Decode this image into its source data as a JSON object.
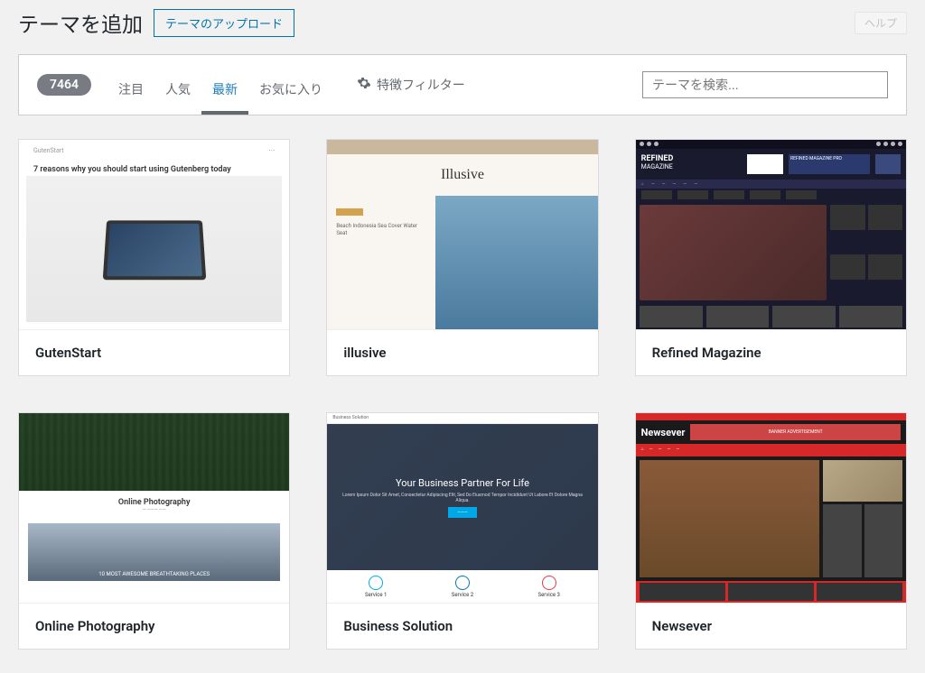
{
  "header": {
    "title": "テーマを追加",
    "upload_btn": "テーマのアップロード",
    "help_btn": "ヘルプ"
  },
  "filter": {
    "count": "7464",
    "tabs": {
      "featured": "注目",
      "popular": "人気",
      "latest": "最新",
      "favorites": "お気に入り"
    },
    "feature_filter": "特徴フィルター",
    "search_placeholder": "テーマを検索..."
  },
  "themes": [
    {
      "name": "GutenStart",
      "preview_title": "GutenStart",
      "preview_text": "7 reasons why you should start using Gutenberg today"
    },
    {
      "name": "illusive",
      "preview_logo": "Illusive",
      "preview_text": "Beach Indonesia Sea Cover Water Seat"
    },
    {
      "name": "Refined Magazine",
      "preview_brand": "REFINED",
      "preview_sub": "MAGAZINE",
      "preview_box": "REFINED MAGAZINE PRO"
    },
    {
      "name": "Online Photography",
      "preview_title": "Online Photography",
      "preview_caption": "10 MOST AWESOME BREATHTAKING PLACES"
    },
    {
      "name": "Business Solution",
      "preview_brand": "Business Solution",
      "preview_hero": "Your Business Partner For Life",
      "preview_text": "Lorem Ipsum Dolor Sit Amet, Consectetur Adipiscing Elit, Sed Do Eiusmod Tempor Incididunt Ut Labore Et Dolore Magna Aliqua.",
      "svc1": "Service 1",
      "svc2": "Service 2",
      "svc3": "Service 3"
    },
    {
      "name": "Newsever",
      "preview_logo": "Newsever",
      "preview_banner": "BANNER ADVERTISEMENT"
    }
  ]
}
